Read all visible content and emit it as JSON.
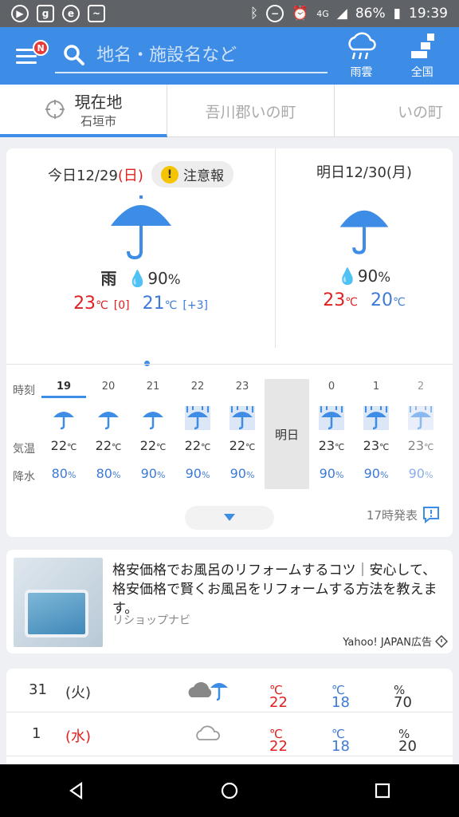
{
  "status_bar": {
    "battery": "86%",
    "time": "19:39",
    "network": "4G"
  },
  "header": {
    "menu_badge": "N",
    "search_placeholder": "地名・施設名など",
    "rain_cloud_label": "雨雲",
    "nationwide_label": "全国"
  },
  "tabs": [
    {
      "label": "現在地",
      "sub": "石垣市"
    },
    {
      "label": "吾川郡いの町"
    },
    {
      "label": "いの町"
    }
  ],
  "today": {
    "label": "今日",
    "date": "12/29",
    "weekday": "(日)",
    "warning": "注意報",
    "condition": "雨",
    "precip": "90",
    "precip_unit": "%",
    "high": "23",
    "high_diff": "[0]",
    "low": "21",
    "low_diff": "[+3]",
    "temp_unit": "℃"
  },
  "tomorrow": {
    "label": "明日",
    "date": "12/30",
    "weekday": "(月)",
    "precip": "90",
    "precip_unit": "%",
    "high": "23",
    "low": "20",
    "temp_unit": "℃"
  },
  "hourly": {
    "row_labels": {
      "time": "時刻",
      "temp": "気温",
      "rain": "降水"
    },
    "tomorrow_label": "明日",
    "hours": [
      {
        "hour": "19",
        "temp": "22",
        "rain": "80",
        "icon": "umbrella-icon"
      },
      {
        "hour": "20",
        "temp": "22",
        "rain": "80",
        "icon": "umbrella-icon"
      },
      {
        "hour": "21",
        "temp": "22",
        "rain": "90",
        "icon": "umbrella-icon"
      },
      {
        "hour": "22",
        "temp": "22",
        "rain": "90",
        "icon": "heavy-rain-umbrella-icon"
      },
      {
        "hour": "23",
        "temp": "22",
        "rain": "90",
        "icon": "heavy-rain-umbrella-icon"
      },
      {
        "hour": "0",
        "temp": "23",
        "rain": "90",
        "icon": "heavy-rain-umbrella-icon"
      },
      {
        "hour": "1",
        "temp": "23",
        "rain": "90",
        "icon": "heavy-rain-umbrella-icon"
      },
      {
        "hour": "2",
        "temp": "23",
        "rain": "90",
        "icon": "heavy-rain-umbrella-icon"
      }
    ],
    "temp_unit": "℃",
    "rain_unit": "%"
  },
  "announce": "17時発表",
  "ad": {
    "title": "格安価格でお風呂のリフォームするコツ｜安心して、格安価格で賢くお風呂をリフォームする方法を教えます。",
    "source": "リショップナビ",
    "credit": "Yahoo! JAPAN広告"
  },
  "weekly": [
    {
      "day": "31",
      "weekday": "(火)",
      "icon": "cloud-rain-icon",
      "high": "22",
      "low": "18",
      "rain": "70"
    },
    {
      "day": "1",
      "weekday": "(水)",
      "icon": "cloud-icon",
      "high": "22",
      "low": "18",
      "rain": "20"
    }
  ],
  "colors": {
    "accent": "#3d8ce6",
    "high_temp": "#e02020",
    "low_temp": "#3d7ad6",
    "warning": "#f5c400"
  }
}
